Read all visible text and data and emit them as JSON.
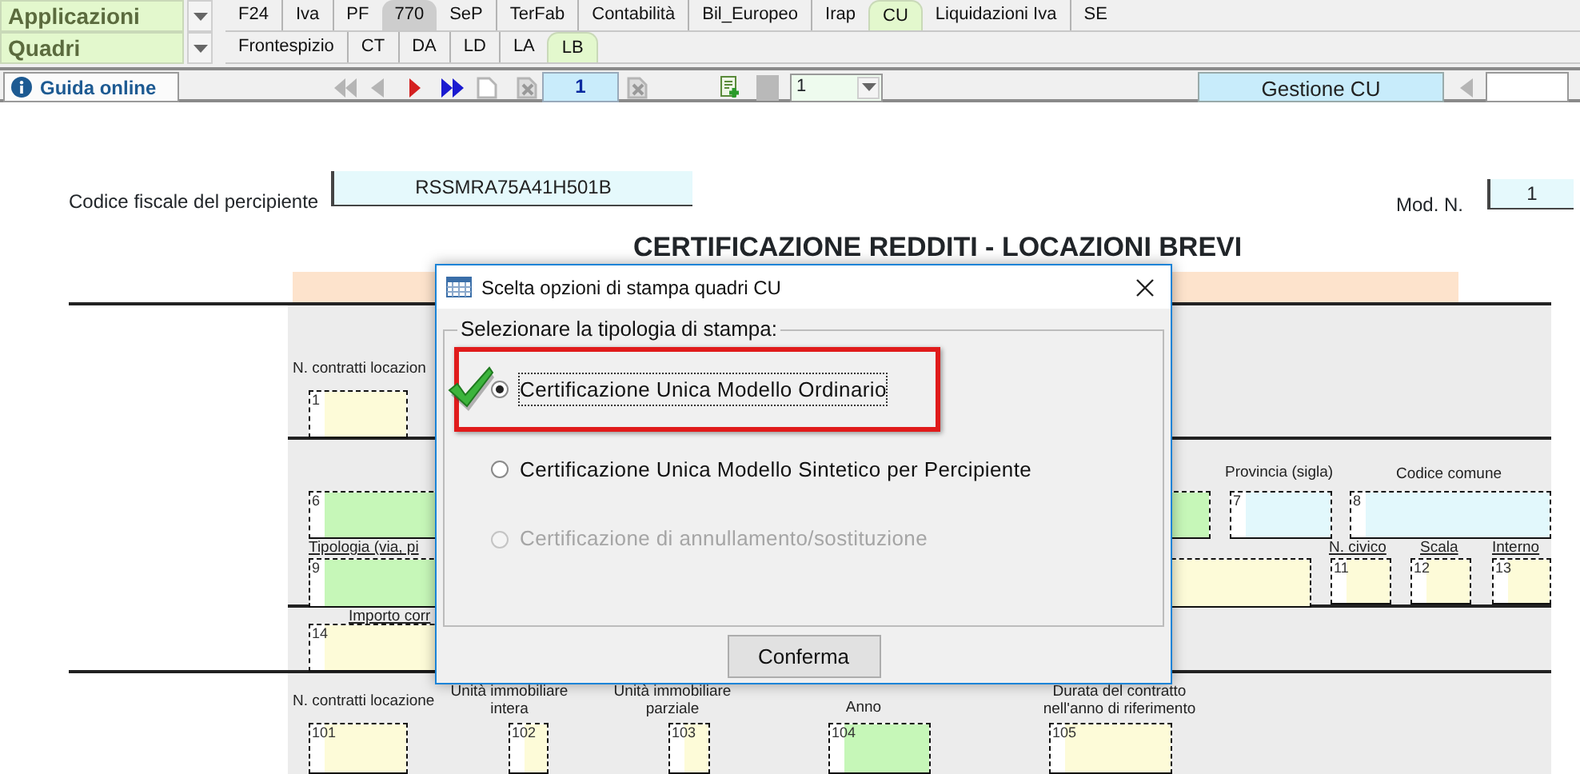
{
  "app_bar": {
    "label": "Applicazioni",
    "tabs": [
      {
        "label": "F24",
        "selected": false,
        "active": false
      },
      {
        "label": "Iva",
        "selected": false,
        "active": false
      },
      {
        "label": "PF",
        "selected": false,
        "active": false
      },
      {
        "label": "770",
        "selected": false,
        "active": true
      },
      {
        "label": "SeP",
        "selected": false,
        "active": false
      },
      {
        "label": "TerFab",
        "selected": false,
        "active": false
      },
      {
        "label": "Contabilità",
        "selected": false,
        "active": false
      },
      {
        "label": "Bil_Europeo",
        "selected": false,
        "active": false
      },
      {
        "label": "Irap",
        "selected": false,
        "active": false
      },
      {
        "label": "CU",
        "selected": true,
        "active": false
      },
      {
        "label": "Liquidazioni Iva",
        "selected": false,
        "active": false
      },
      {
        "label": "SE",
        "selected": false,
        "active": false
      }
    ]
  },
  "quadri_bar": {
    "label": "Quadri",
    "tabs": [
      {
        "label": "Frontespizio",
        "selected": false
      },
      {
        "label": "CT",
        "selected": false
      },
      {
        "label": "DA",
        "selected": false
      },
      {
        "label": "LD",
        "selected": false
      },
      {
        "label": "LA",
        "selected": false
      },
      {
        "label": "LB",
        "selected": true
      }
    ]
  },
  "toolbar": {
    "help_button": "Guida online",
    "record_field": "1",
    "page_select": "1",
    "manage_button": "Gestione CU"
  },
  "form": {
    "fiscal_code_label": "Codice fiscale del percipiente",
    "fiscal_code": "RSSMRA75A41H501B",
    "mod_label": "Mod. N.",
    "mod_number": "1",
    "title": "CERTIFICAZIONE REDDITI - LOCAZIONI BREVI",
    "labels": [
      "N. contratti locazion",
      "Provincia (sigla)",
      "Codice comune",
      "Tipologia (via, pi",
      "N. civico",
      "Scala",
      "Interno",
      "Importo corr",
      "N. contratti locazione",
      "Unità immobiliare intera",
      "Unità immobiliare parziale",
      "Anno",
      "Durata del contratto nell'anno di riferimento"
    ],
    "fields": [
      {
        "number": "1",
        "color": "#fdfbd8"
      },
      {
        "number": "6",
        "color": "#c6f7b8"
      },
      {
        "number": "7",
        "color": "#e2f8fc"
      },
      {
        "number": "8",
        "color": "#e2f8fc"
      },
      {
        "number": "9",
        "color": "#c6f7b8"
      },
      {
        "color": "#fdfbd8"
      },
      {
        "number": "11",
        "color": "#fdfbd8"
      },
      {
        "number": "12",
        "color": "#fdfbd8"
      },
      {
        "number": "13",
        "color": "#fdfbd8"
      },
      {
        "number": "14",
        "color": "#fdfbd8"
      },
      {
        "number": "101",
        "color": "#fdfbd8"
      },
      {
        "number": "102",
        "color": "#fdfbd8"
      },
      {
        "number": "103",
        "color": "#fdfbd8"
      },
      {
        "number": "104",
        "color": "#c6f7b8"
      },
      {
        "number": "105",
        "color": "#fdfbd8"
      }
    ]
  },
  "dialog": {
    "title": "Scelta opzioni di stampa quadri CU",
    "group_label": "Selezionare la tipologia di stampa:",
    "options": [
      {
        "label": "Certificazione Unica Modello Ordinario",
        "selected": true,
        "disabled": false,
        "annotated": true
      },
      {
        "label": "Certificazione Unica Modello Sintetico per Percipiente",
        "selected": false,
        "disabled": false,
        "annotated": false
      },
      {
        "label": "Certificazione di annullamento/sostituzione",
        "selected": false,
        "disabled": true,
        "annotated": false
      }
    ],
    "confirm_button": "Conferma"
  }
}
